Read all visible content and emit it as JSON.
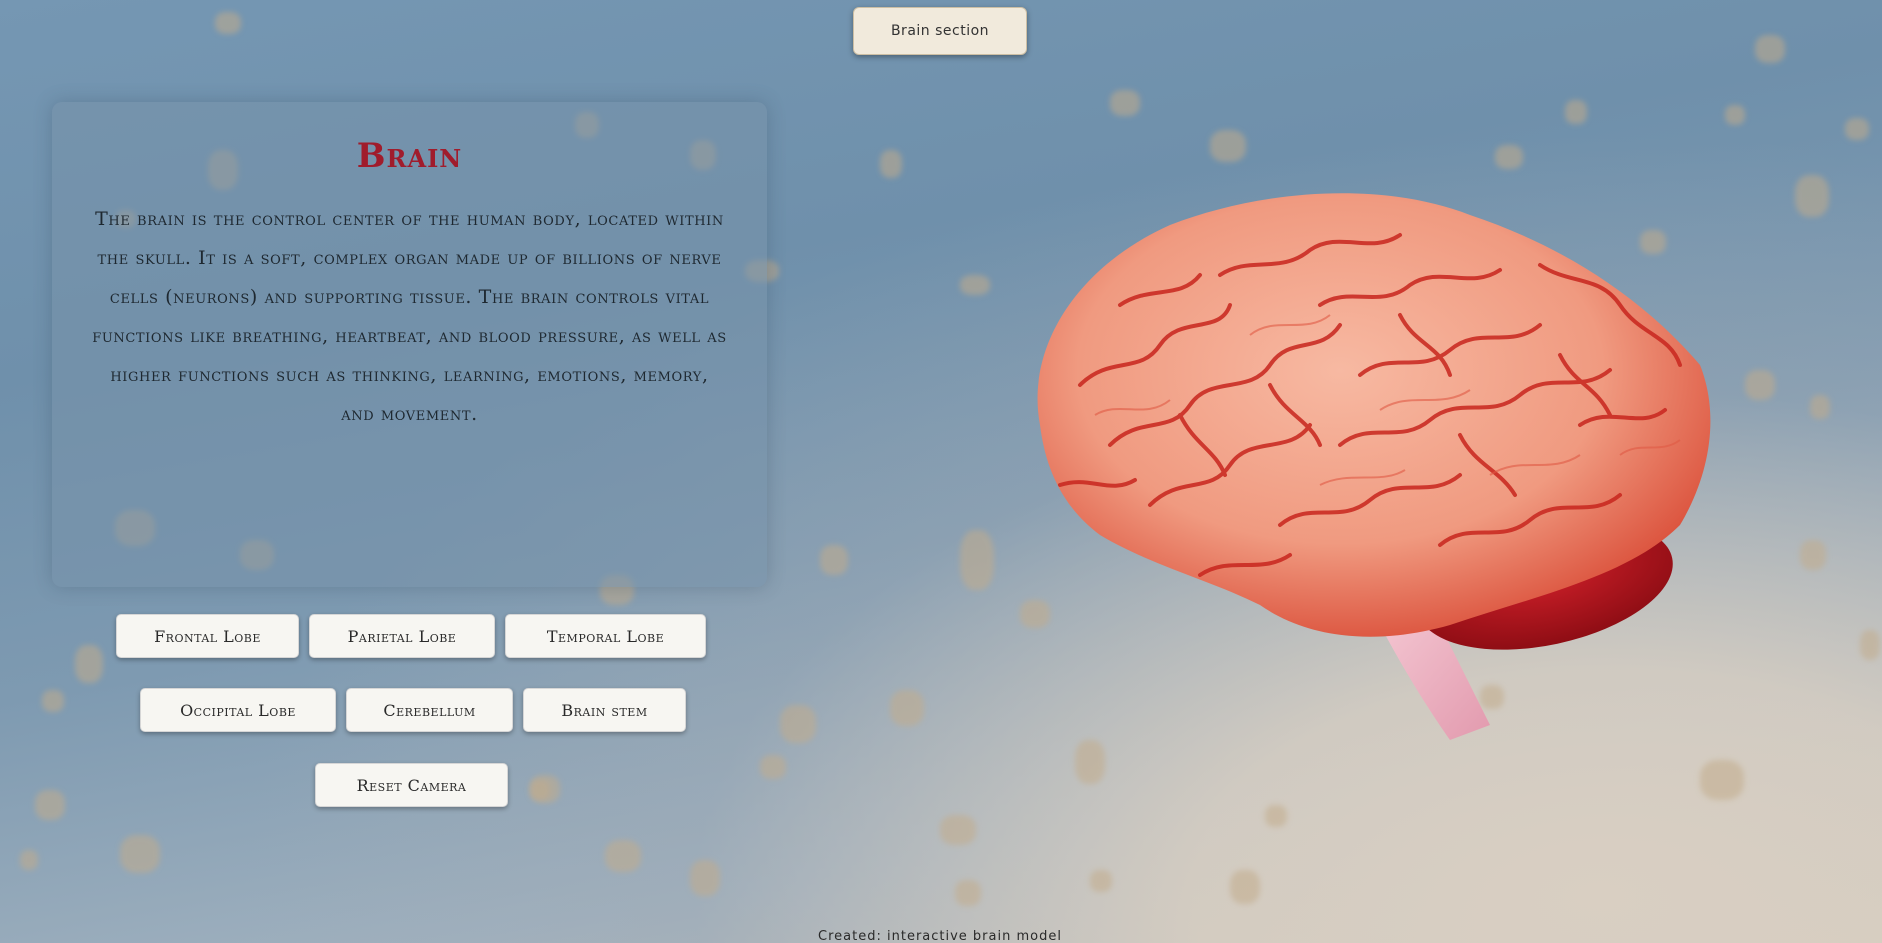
{
  "header": {
    "top_button_label": "Brain section"
  },
  "info_panel": {
    "title": "Brain",
    "description": "The brain is the control center of the human body, located within the skull. It is a soft, complex organ made up of billions of nerve cells (neurons) and supporting tissue. The brain controls vital functions like breathing, heartbeat, and blood pressure, as well as higher functions such as thinking, learning, emotions, memory, and movement."
  },
  "controls": {
    "row1": [
      "Frontal Lobe",
      "Parietal Lobe",
      "Temporal Lobe"
    ],
    "row2": [
      "Occipital Lobe",
      "Cerebellum",
      "Brain stem"
    ],
    "reset_label": "Reset Camera"
  },
  "footer": {
    "text": "Created: interactive brain model"
  },
  "colors": {
    "title_red": "#a01c2c",
    "brain_pink": "#f0a58e",
    "brain_groove": "#c8261e",
    "cerebellum": "#b5121b",
    "brainstem": "#eab8c6"
  },
  "icons": {
    "model": "brain-3d-model"
  }
}
